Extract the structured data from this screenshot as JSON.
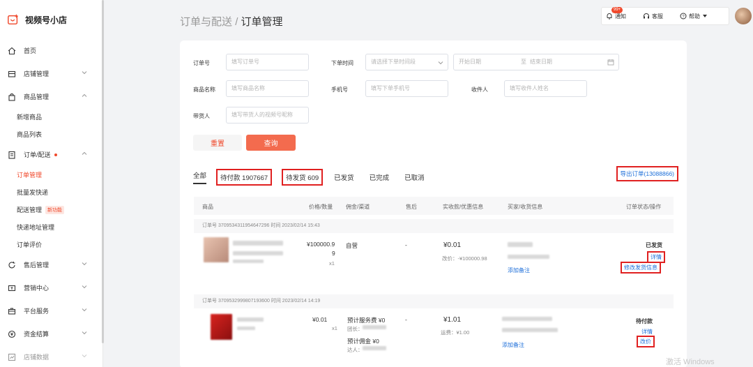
{
  "app": {
    "name": "视频号小店"
  },
  "sidebar": {
    "items": [
      {
        "label": "首页"
      },
      {
        "label": "店铺管理"
      },
      {
        "label": "商品管理",
        "children": [
          "新增商品",
          "商品列表"
        ]
      },
      {
        "label": "订单/配送",
        "children": [
          "订单管理",
          "批量发快递",
          "配送管理",
          "快递地址管理",
          "订单评价"
        ],
        "new_badge": "新功能"
      },
      {
        "label": "售后管理"
      },
      {
        "label": "营销中心"
      },
      {
        "label": "平台服务"
      },
      {
        "label": "资金结算"
      },
      {
        "label": "店铺数据"
      }
    ]
  },
  "header": {
    "breadcrumb_parent": "订单与配送",
    "breadcrumb_sep": "/",
    "breadcrumb_current": "订单管理",
    "notify_label": "通知",
    "notify_badge": "99+",
    "service_label": "客服",
    "help_label": "帮助"
  },
  "filters": {
    "order_no_label": "订单号",
    "order_no_placeholder": "填写订单号",
    "time_label": "下单时间",
    "time_select": "请选择下单时间段",
    "start_date": "开始日期",
    "date_sep": "至",
    "end_date": "结束日期",
    "product_label": "商品名称",
    "product_placeholder": "填写商品名称",
    "phone_label": "手机号",
    "phone_placeholder": "填写下单手机号",
    "receiver_label": "收件人",
    "receiver_placeholder": "填写收件人姓名",
    "promoter_label": "带货人",
    "promoter_placeholder": "填写带货人的视频号昵称",
    "reset_label": "重置",
    "query_label": "查询"
  },
  "tabs": {
    "all": "全部",
    "unpaid": "待付款 1907667",
    "unshipped": "待发货 609",
    "shipped": "已发货",
    "completed": "已完成",
    "cancelled": "已取消",
    "export": "导出订单(13088866)"
  },
  "table": {
    "headers": [
      "商品",
      "价格/数量",
      "佣金/渠道",
      "售后",
      "实收款/优惠信息",
      "买家/收货信息",
      "订单状态/操作"
    ]
  },
  "orders": [
    {
      "meta": "订单号 3709534311954647296   时间 2023/02/14 15:43",
      "price": "¥100000.9",
      "price_tail": "9",
      "qty": "x1",
      "channel": "自营",
      "aftersale": "-",
      "received": "¥0.01",
      "discount": "改价：-¥100000.98",
      "note_link": "添加备注",
      "status": "已发货",
      "detail_link": "详情",
      "modify_link": "修改发货信息"
    },
    {
      "meta": "订单号 3709532999807193600   时间 2023/02/14 14:19",
      "price": "¥0.01",
      "qty": "x1",
      "service_fee": "预计服务费 ¥0",
      "leader": "团长：",
      "commission": "预计佣金 ¥0",
      "promoter": "达人：",
      "aftersale": "-",
      "received": "¥1.01",
      "shipping": "运费：¥1.00",
      "note_link": "添加备注",
      "status": "待付款",
      "detail_link": "详情",
      "modify_link": "改价"
    }
  ],
  "watermark": "激活 Windows"
}
